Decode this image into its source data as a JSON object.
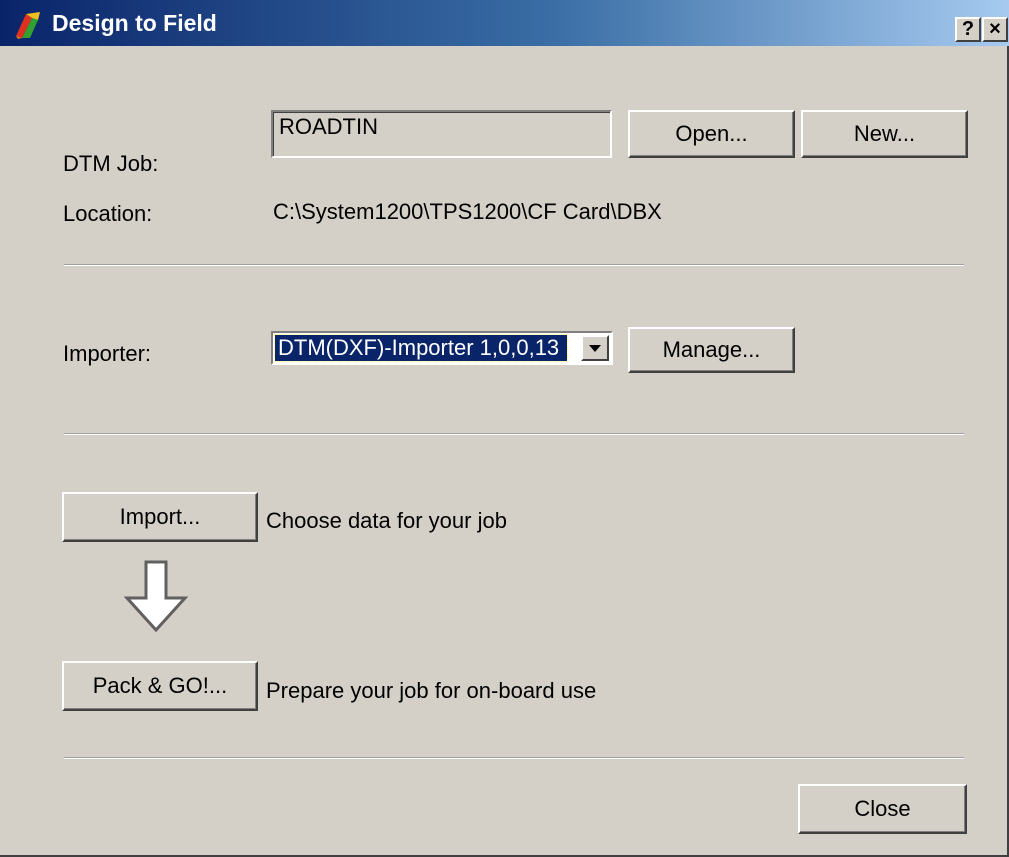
{
  "window": {
    "title": "Design to Field",
    "help_label": "?",
    "close_label": "×"
  },
  "job": {
    "label": "DTM Job:",
    "value": "ROADTIN",
    "open_label": "Open...",
    "new_label": "New...",
    "location_label": "Location:",
    "location_value": "C:\\System1200\\TPS1200\\CF Card\\DBX"
  },
  "importer": {
    "label": "Importer:",
    "selected": "DTM(DXF)-Importer 1,0,0,13",
    "manage_label": "Manage..."
  },
  "steps": {
    "import_label": "Import...",
    "import_desc": "Choose data for your job",
    "pack_label": "Pack & GO!...",
    "pack_desc": "Prepare your job for on-board use",
    "arrow_icon": "down-arrow-icon"
  },
  "footer": {
    "close_label": "Close"
  }
}
